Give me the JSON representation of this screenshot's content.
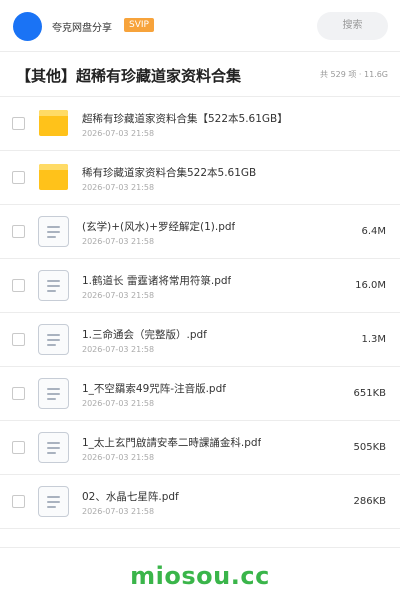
{
  "header": {
    "owner_name": "夸克网盘分享",
    "badge": "SVIP",
    "search_placeholder": "搜索"
  },
  "title_bar": {
    "title": "【其他】超稀有珍藏道家资料合集",
    "meta": "共 529 项 · 11.6G"
  },
  "files": [
    {
      "type": "folder",
      "name": "超稀有珍藏道家资料合集【522本5.61GB】",
      "date": "2026-07-03 21:58",
      "size": ""
    },
    {
      "type": "folder",
      "name": "稀有珍藏道家资料合集522本5.61GB",
      "date": "2026-07-03 21:58",
      "size": ""
    },
    {
      "type": "doc",
      "name": "(玄学)+(风水)+罗经解定(1).pdf",
      "date": "2026-07-03 21:58",
      "size": "6.4M"
    },
    {
      "type": "doc",
      "name": "1.鹤道长  雷霆诸将常用符箓.pdf",
      "date": "2026-07-03 21:58",
      "size": "16.0M"
    },
    {
      "type": "doc",
      "name": "1.三命通会（完整版）.pdf",
      "date": "2026-07-03 21:58",
      "size": "1.3M"
    },
    {
      "type": "doc",
      "name": "1_不空羂索49咒阵-注音版.pdf",
      "date": "2026-07-03 21:58",
      "size": "651KB"
    },
    {
      "type": "doc",
      "name": "1_太上玄門啟請安奉二時課誦金科.pdf",
      "date": "2026-07-03 21:58",
      "size": "505KB"
    },
    {
      "type": "doc",
      "name": "02、水晶七星阵.pdf",
      "date": "2026-07-03 21:58",
      "size": "286KB"
    }
  ],
  "watermark": "miosou.cc",
  "colors": {
    "accent": "#1a73f5",
    "badge": "#f7a33b",
    "folder": "#ffc21a",
    "watermark": "#3ab54a"
  }
}
